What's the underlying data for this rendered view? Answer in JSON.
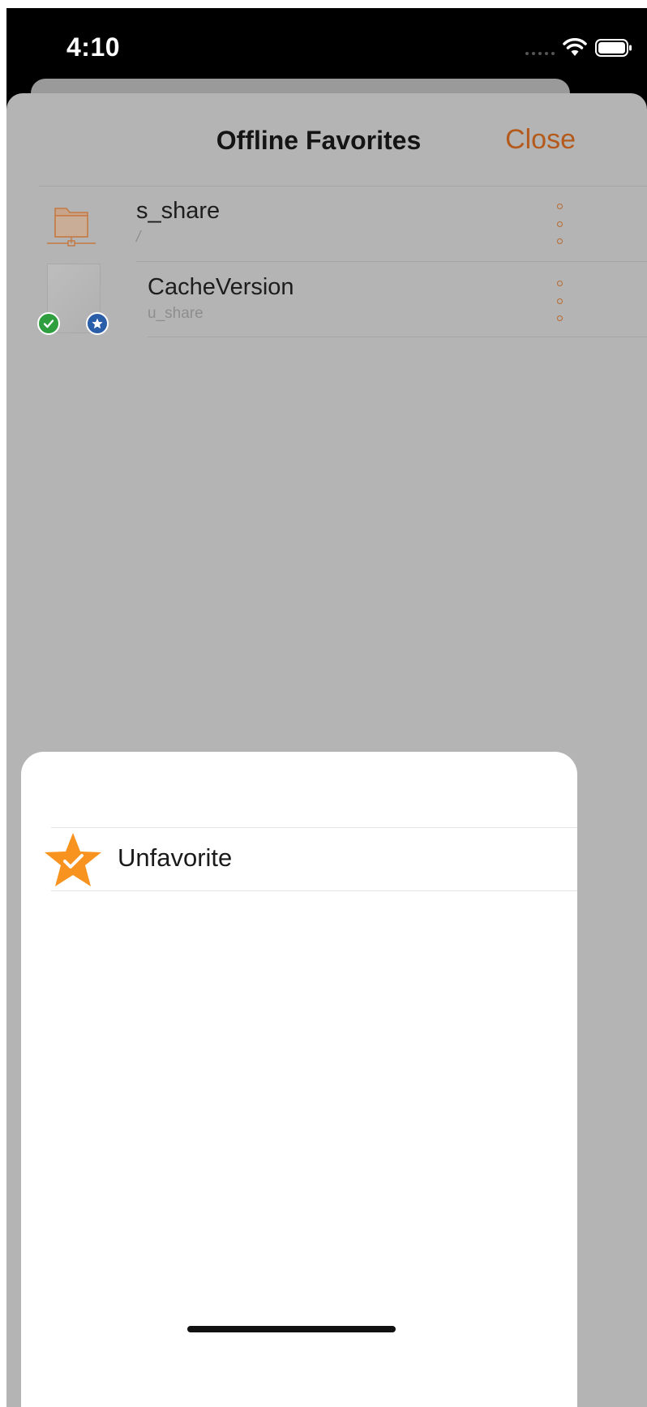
{
  "status_bar": {
    "time": "4:10"
  },
  "header": {
    "title": "Offline Favorites",
    "close_label": "Close"
  },
  "list": {
    "items": [
      {
        "title": "s_share",
        "subtitle": "/",
        "icon": "network-share-icon"
      },
      {
        "title": "CacheVersion",
        "subtitle": "u_share",
        "icon": "file-icon",
        "badges": [
          "synced-check-icon",
          "favorite-star-badge-icon"
        ]
      }
    ]
  },
  "action_sheet": {
    "actions": [
      {
        "label": "Unfavorite",
        "icon": "unfavorite-star-icon"
      }
    ]
  },
  "colors": {
    "accent": "#b35a1c",
    "star_orange": "#f7931e",
    "check_green": "#2e9e3f",
    "star_badge_blue": "#2a5ea8"
  }
}
